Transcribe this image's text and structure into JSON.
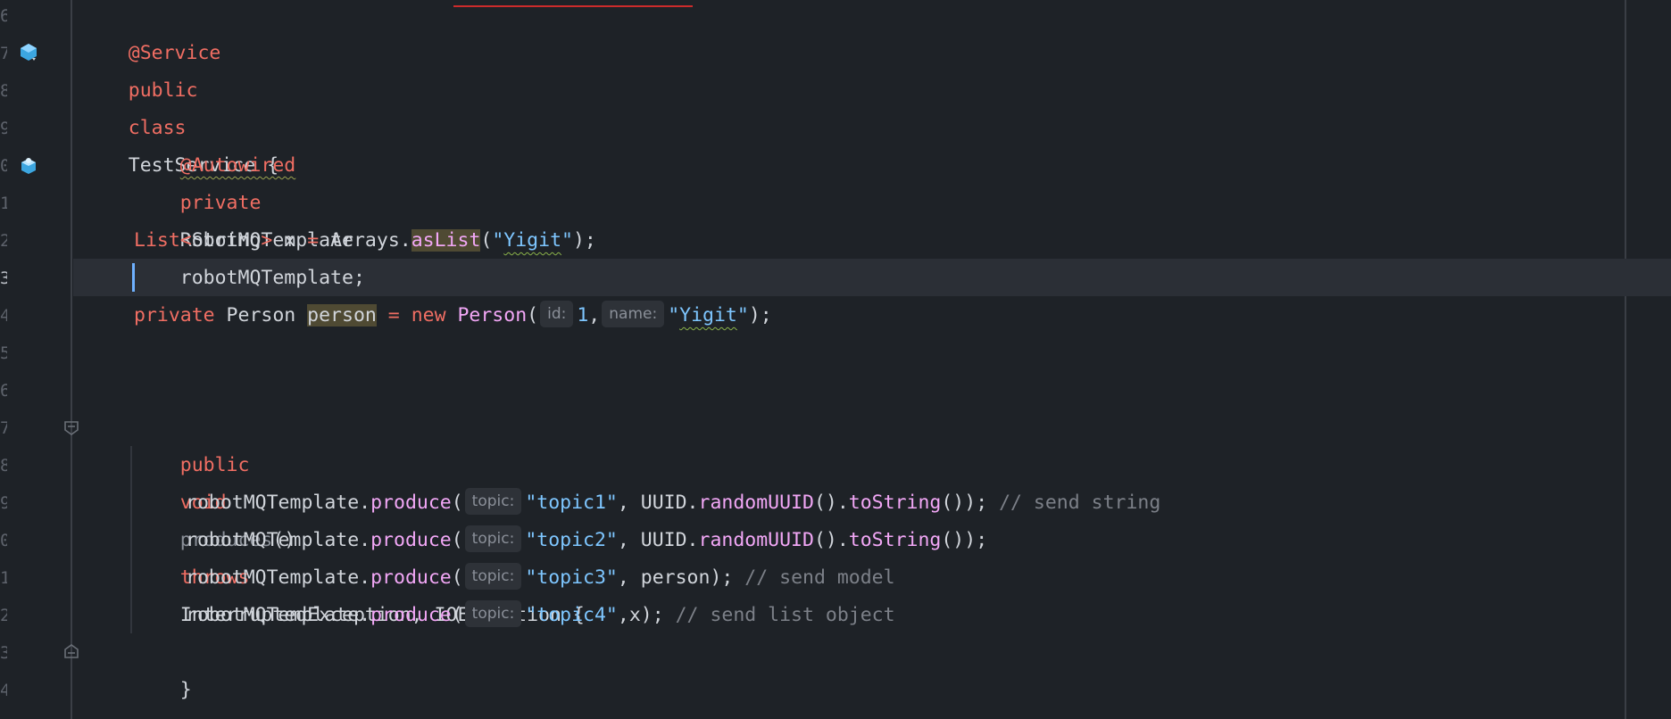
{
  "editor": {
    "line_numbers": [
      "6",
      "7",
      "8",
      "9",
      "0",
      "1",
      "2",
      "3",
      "4",
      "5",
      "6",
      "7",
      "8",
      "9",
      "0",
      "1",
      "2",
      "3",
      "4"
    ],
    "lines": {
      "service_annotation": "@Service",
      "class_decl": {
        "kw_public": "public",
        "kw_class": "class",
        "name": "TestService",
        "brace": " {"
      },
      "autowired": "@Autowired",
      "field_decl": {
        "kw_private": "private",
        "type": "RobotMQTemplate",
        "name": "robotMQTemplate",
        "end": ";"
      },
      "list_decl": {
        "type": "List",
        "lt": "<",
        "generic": "String",
        "gt": ">",
        "name": " x ",
        "eq": "=",
        "recv": " Arrays.",
        "method": "asList",
        "open": "(",
        "quote_open": "\"",
        "str": "Yigit",
        "quote_close": "\"",
        "close": ");"
      },
      "person_decl": {
        "kw_private": "private",
        "type": " Person ",
        "name": "person",
        "eq": " = ",
        "kw_new": "new",
        "ctor": " Person",
        "open": "(",
        "hint_id": "id:",
        "num": "1",
        "comma": ",",
        "hint_name": "name:",
        "quote_open": "\"",
        "str": "Yigit",
        "quote_close": "\"",
        "close": ");"
      },
      "method_decl": {
        "kw_public": "public",
        "kw_void": "void",
        "name": "produces",
        "parens": "()",
        "kw_throws": "throws",
        "exceptions": "InterruptedException, IOException {"
      },
      "calls": [
        {
          "recv": "robotMQTemplate.",
          "method": "produce",
          "open": "(",
          "hint": "topic:",
          "str": "\"topic1\"",
          "mid": ", UUID.",
          "m2": "randomUUID",
          "p2": "().",
          "m3": "toString",
          "end": "());",
          "comment": " // send string"
        },
        {
          "recv": "robotMQTemplate.",
          "method": "produce",
          "open": "(",
          "hint": "topic:",
          "str": "\"topic2\"",
          "mid": ", UUID.",
          "m2": "randomUUID",
          "p2": "().",
          "m3": "toString",
          "end": "());",
          "comment": ""
        },
        {
          "recv": "robotMQTemplate.",
          "method": "produce",
          "open": "(",
          "hint": "topic:",
          "str": "\"topic3\"",
          "rest": ", person);",
          "comment": " // send model"
        },
        {
          "recv": "robotMQTemplate.",
          "method": "produce",
          "open": "(",
          "hint": "topic:",
          "str": "\"topic4\"",
          "rest": ",x);",
          "comment": " // send list object"
        }
      ],
      "closing_brace": "}"
    }
  },
  "colors": {
    "background": "#1e2227",
    "keyword": "#f06e63",
    "method": "#f2a7f6",
    "string": "#7ec6ff",
    "comment": "#7c8088",
    "caret": "#6fb1ff"
  },
  "icons": {
    "class_gutter": "bean-class-icon",
    "field_gutter": "autowired-bean-icon",
    "fold_start": "fold-collapse-icon",
    "fold_end": "fold-end-icon"
  }
}
